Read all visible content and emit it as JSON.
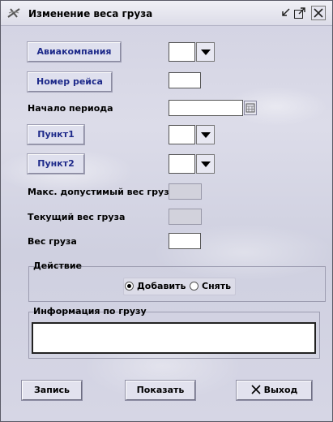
{
  "window": {
    "title": "Изменение веса груза"
  },
  "fields": {
    "airline_button": "Авиакомпания",
    "flight_button": "Номер рейса",
    "period_label": "Начало периода",
    "point1_button": "Пункт1",
    "point2_button": "Пункт2",
    "max_weight_label": "Макс. допустимый вес груза",
    "current_weight_label": "Текущий вес груза",
    "weight_label": "Вес груза"
  },
  "action_group": {
    "title": "Действие",
    "options": [
      "Добавить",
      "Снять"
    ],
    "selected": "Добавить"
  },
  "info_group": {
    "title": "Информация по грузу"
  },
  "buttons": {
    "record": "Запись",
    "show": "Показать",
    "exit": "Выход"
  }
}
